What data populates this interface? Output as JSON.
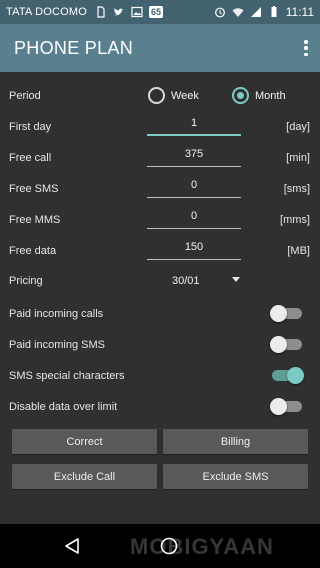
{
  "status_bar": {
    "carrier": "TATA DOCOMO",
    "badge": "65",
    "time": "11:11"
  },
  "app_bar": {
    "title": "PHONE PLAN"
  },
  "period": {
    "label": "Period",
    "options": [
      "Week",
      "Month"
    ],
    "selected": "Month"
  },
  "fields": [
    {
      "label": "First day",
      "value": "1",
      "unit": "[day]"
    },
    {
      "label": "Free call",
      "value": "375",
      "unit": "[min]"
    },
    {
      "label": "Free SMS",
      "value": "0",
      "unit": "[sms]"
    },
    {
      "label": "Free MMS",
      "value": "0",
      "unit": "[mms]"
    },
    {
      "label": "Free data",
      "value": "150",
      "unit": "[MB]"
    }
  ],
  "pricing": {
    "label": "Pricing",
    "value": "30/01"
  },
  "toggles": [
    {
      "label": "Paid incoming calls",
      "on": false
    },
    {
      "label": "Paid incoming SMS",
      "on": false
    },
    {
      "label": "SMS special characters",
      "on": true
    },
    {
      "label": "Disable data over limit",
      "on": false
    }
  ],
  "buttons": {
    "correct": "Correct",
    "billing": "Billing",
    "exclude_call": "Exclude Call",
    "exclude_sms": "Exclude SMS"
  },
  "watermark": "MOBIGYAAN",
  "colors": {
    "accent": "#7bcbc4",
    "app_bar": "#5a7f8e",
    "status_bar": "#43626f",
    "background": "#303030"
  },
  "icons": [
    "sim-icon",
    "twitter-icon",
    "image-icon",
    "alarm-icon",
    "wifi-icon",
    "signal-icon",
    "battery-icon",
    "overflow-menu-icon",
    "dropdown-caret-icon",
    "back-icon",
    "home-icon"
  ]
}
